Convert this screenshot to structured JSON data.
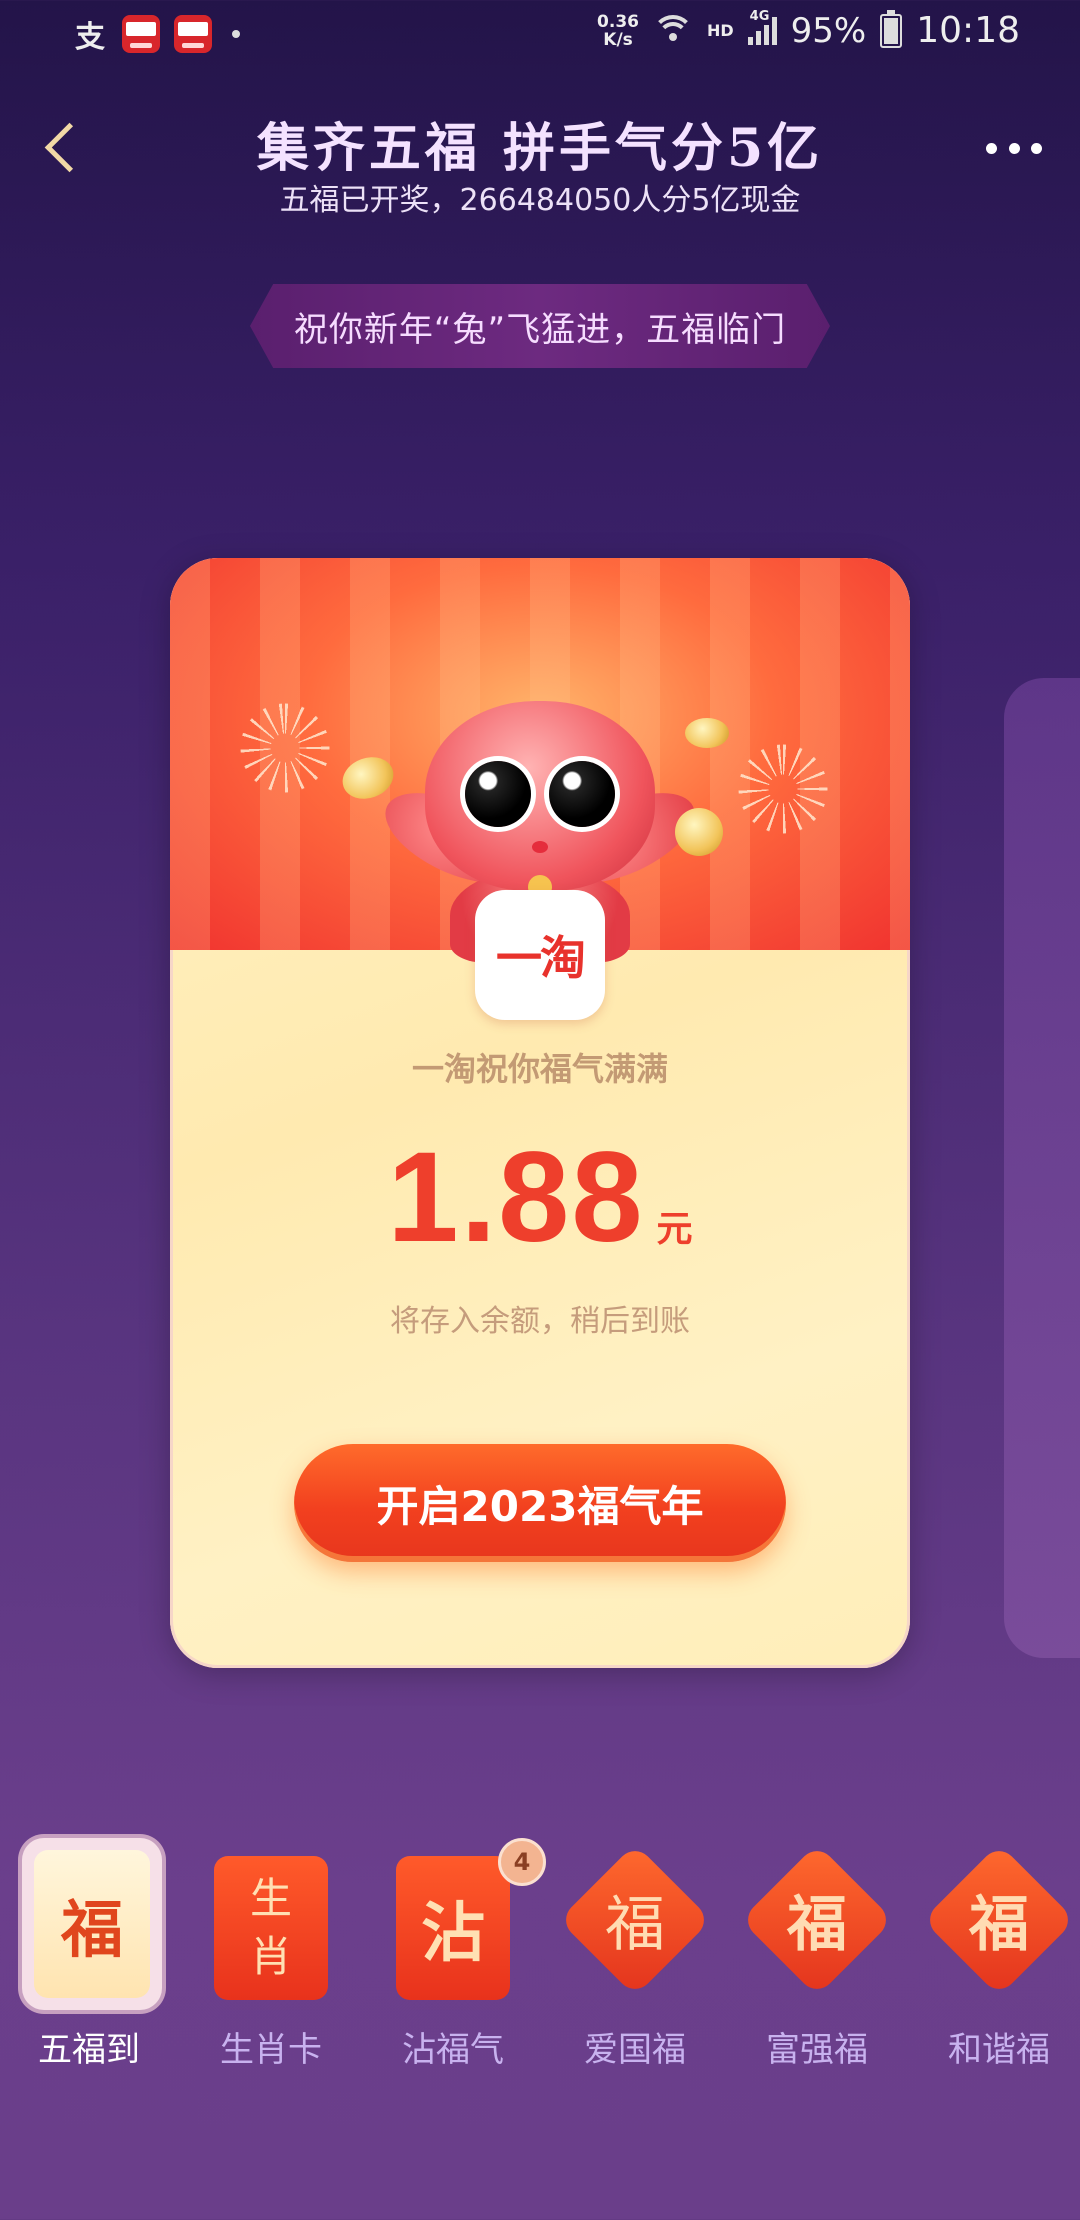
{
  "status_bar": {
    "net_speed": "0.36",
    "net_unit": "K/s",
    "network": "HD",
    "gen": "4G",
    "battery": "95%",
    "time": "10:18"
  },
  "header": {
    "title": "集齐五福 拼手气分5亿",
    "subtitle": "五福已开奖，266484050人分5亿现金",
    "greeting": "祝你新年“兔”飞猛进，五福临门"
  },
  "card": {
    "brand_logo": "一淘",
    "wish": "一淘祝你福气满满",
    "amount": "1.88",
    "unit": "元",
    "note": "将存入余额，稍后到账",
    "cta": "开启2023福气年"
  },
  "tabs": [
    {
      "label": "五福到",
      "glyph": "福",
      "active": true
    },
    {
      "label": "生肖卡",
      "glyph_top": "生",
      "glyph_bottom": "肖"
    },
    {
      "label": "沾福气",
      "glyph": "沾",
      "badge": "4"
    },
    {
      "label": "爱国福",
      "glyph": "福"
    },
    {
      "label": "富强福",
      "glyph": "福"
    },
    {
      "label": "和谐福",
      "glyph": "福"
    }
  ],
  "colors": {
    "background_top": "#231449",
    "background_bottom": "#6a3e8a",
    "accent_red": "#ee3f2c",
    "cta_orange": "#f2401f",
    "card_cream": "#fff3c6"
  },
  "icons": {
    "back": "back-arrow-icon",
    "more": "more-dots-icon",
    "wifi": "wifi-icon",
    "signal": "signal-icon",
    "battery": "battery-icon"
  }
}
